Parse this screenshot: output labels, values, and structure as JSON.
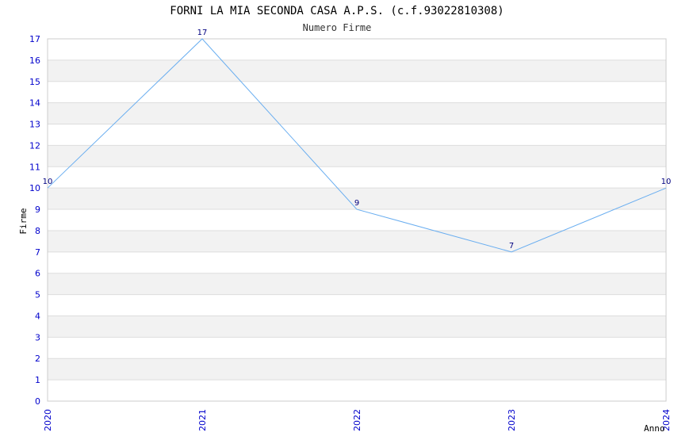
{
  "chart_data": {
    "type": "line",
    "title": "FORNI LA MIA SECONDA CASA A.P.S. (c.f.93022810308)",
    "subtitle": "Numero Firme",
    "xlabel": "Anno",
    "ylabel": "Firme",
    "categories": [
      "2020",
      "2021",
      "2022",
      "2023",
      "2024"
    ],
    "series": [
      {
        "values": [
          10,
          17,
          9,
          7,
          10
        ]
      }
    ],
    "ylim": [
      0,
      17
    ],
    "yticks": [
      0,
      1,
      2,
      3,
      4,
      5,
      6,
      7,
      8,
      9,
      10,
      11,
      12,
      13,
      14,
      15,
      16,
      17
    ],
    "grid": "horizontal alternating bands",
    "colors": {
      "line": "#6aaef0",
      "tick_text": "#0000cc",
      "data_label": "#000080",
      "band": "#f2f2f2",
      "grid": "#dddddd"
    }
  }
}
